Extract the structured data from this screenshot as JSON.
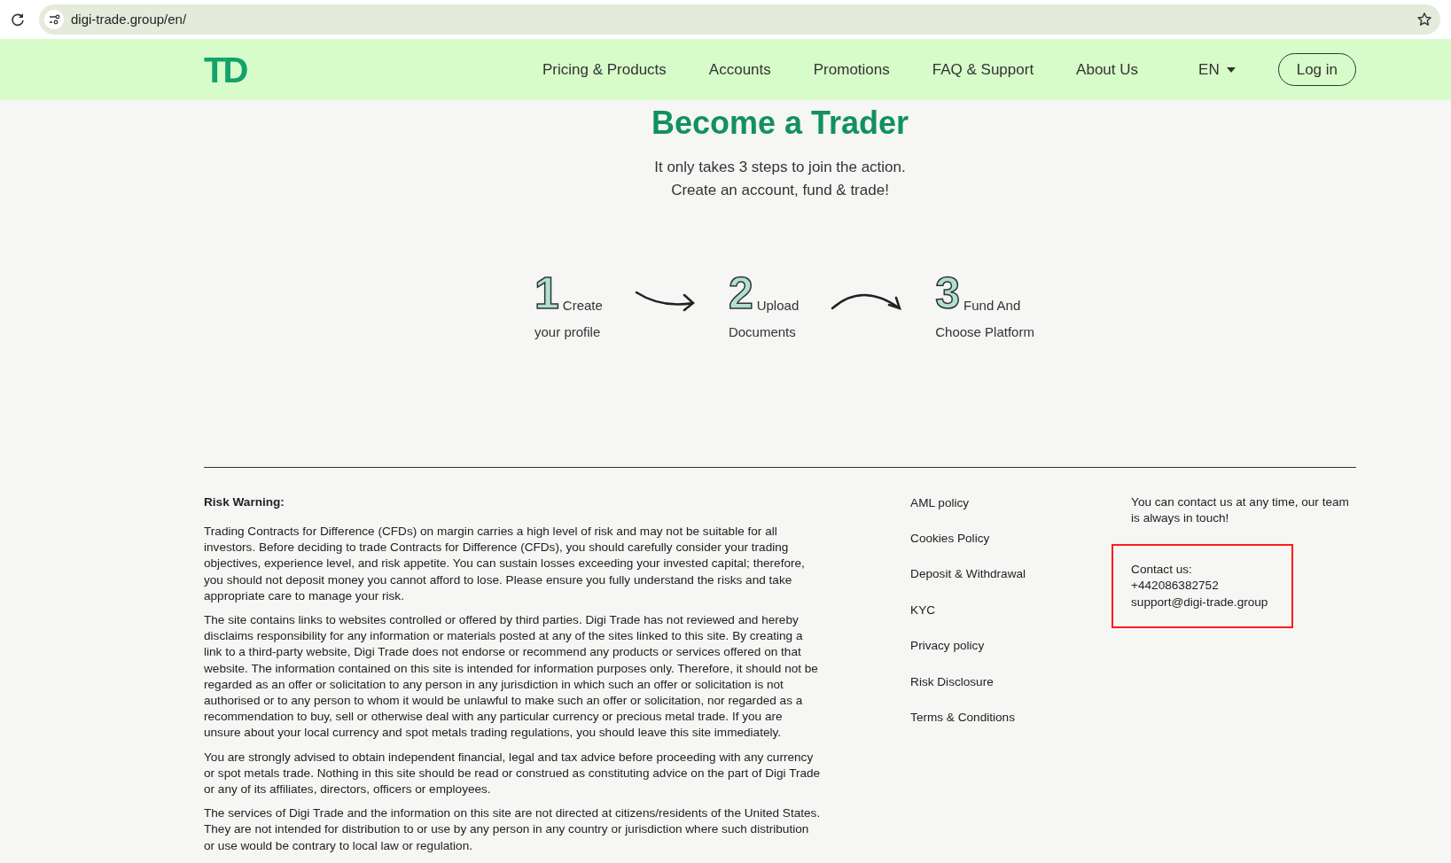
{
  "browser": {
    "url": "digi-trade.group/en/"
  },
  "navbar": {
    "logo": "TD",
    "items": [
      "Pricing & Products",
      "Accounts",
      "Promotions",
      "FAQ & Support",
      "About Us"
    ],
    "language": "EN",
    "login": "Log in"
  },
  "hero": {
    "title": "Become a Trader",
    "subtitle_lines": [
      "It only takes 3 steps to join the action.",
      "Create an account, fund & trade!"
    ],
    "steps": [
      {
        "number": "1",
        "first": "Create",
        "second": "your profile"
      },
      {
        "number": "2",
        "first": "Upload",
        "second": "Documents"
      },
      {
        "number": "3",
        "first": "Fund And",
        "second": "Choose Platform"
      }
    ]
  },
  "footer": {
    "risk_title": "Risk Warning:",
    "paragraphs": [
      "Trading Contracts for Difference (CFDs) on margin carries a high level of risk and may not be suitable for all investors. Before deciding to trade Contracts for Difference (CFDs), you should carefully consider your trading objectives, experience level, and risk appetite. You can sustain losses exceeding your invested capital; therefore, you should not deposit money you cannot afford to lose. Please ensure you fully understand the risks and take appropriate care to manage your risk.",
      "The site contains links to websites controlled or offered by third parties. Digi Trade has not reviewed and hereby disclaims responsibility for any information or materials posted at any of the sites linked to this site. By creating a link to a third-party website, Digi Trade does not endorse or recommend any products or services offered on that website. The information contained on this site is intended for information purposes only. Therefore, it should not be regarded as an offer or solicitation to any person in any jurisdiction in which such an offer or solicitation is not authorised or to any person to whom it would be unlawful to make such an offer or solicitation, nor regarded as a recommendation to buy, sell or otherwise deal with any particular currency or precious metal trade. If you are unsure about your local currency and spot metals trading regulations, you should leave this site immediately.",
      "You are strongly advised to obtain independent financial, legal and tax advice before proceeding with any currency or spot metals trade. Nothing in this site should be read or construed as constituting advice on the part of Digi Trade or any of its affiliates, directors, officers or employees.",
      "The services of Digi Trade and the information on this site are not directed at citizens/residents of the United States. They are not intended for distribution to or use by any person in any country or jurisdiction where such distribution or use would be contrary to local law or regulation."
    ],
    "links": [
      "AML policy",
      "Cookies Policy",
      "Deposit & Withdrawal",
      "KYC",
      "Privacy policy",
      "Risk Disclosure",
      "Terms & Conditions"
    ],
    "contact_intro": "You can contact us at any time, our team is always in touch!",
    "contact": {
      "highlighted": true,
      "lines": [
        "Contact us:",
        "+442086382752",
        "support@digi-trade.group"
      ]
    }
  }
}
